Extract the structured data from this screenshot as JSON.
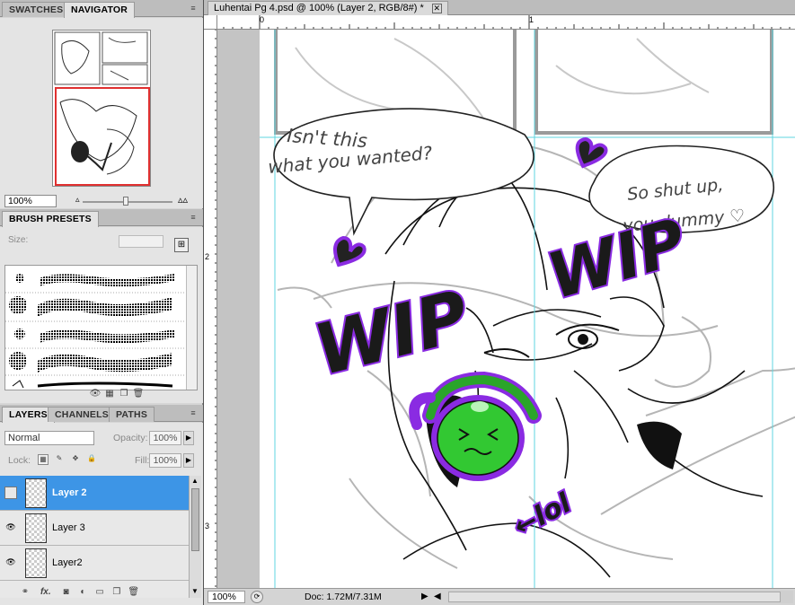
{
  "document": {
    "tab_title": "Luhentai Pg 4.psd @ 100% (Layer 2, RGB/8#) *",
    "close_symbol": "✕",
    "ruler": {
      "top_marks": [
        "0",
        "1"
      ],
      "left_marks": [
        "2",
        "3"
      ]
    }
  },
  "navigator_panel": {
    "tabs": [
      "SWATCHES",
      "NAVIGATOR"
    ],
    "active_tab": "NAVIGATOR",
    "zoom_value": "100%"
  },
  "brush_presets_panel": {
    "tab": "BRUSH PRESETS",
    "size_label": "Size:"
  },
  "layers_panel": {
    "tabs": [
      "LAYERS",
      "CHANNELS",
      "PATHS"
    ],
    "blend_mode": "Normal",
    "opacity_label": "Opacity:",
    "opacity_value": "100%",
    "lock_label": "Lock:",
    "fill_label": "Fill:",
    "fill_value": "100%",
    "layers": [
      {
        "name": "Layer 2",
        "selected": true,
        "visible": false
      },
      {
        "name": "Layer 3",
        "selected": false,
        "visible": true
      },
      {
        "name": "Layer2",
        "selected": false,
        "visible": true
      }
    ],
    "footer_icons": [
      "link-icon",
      "fx-icon",
      "mask-icon",
      "adjustment-icon",
      "group-icon",
      "new-layer-icon",
      "trash-icon"
    ],
    "fx_label": "fx."
  },
  "status_bar": {
    "zoom": "100%",
    "doc_info": "Doc: 1.72M/7.31M"
  },
  "artwork_text": {
    "bubble_left": [
      "Isn't this",
      "what you wanted?"
    ],
    "bubble_right": [
      "So shut up,",
      "you dummy ♡"
    ],
    "wip_left": "WIP",
    "wip_right": "WIP",
    "lol": "←lol"
  },
  "colors": {
    "accent_selected": "#3d95e6",
    "guide": "#5fd6e0",
    "wip_purple": "#8a2be2",
    "blob_green": "#32c832",
    "nav_frame": "#e03030"
  }
}
